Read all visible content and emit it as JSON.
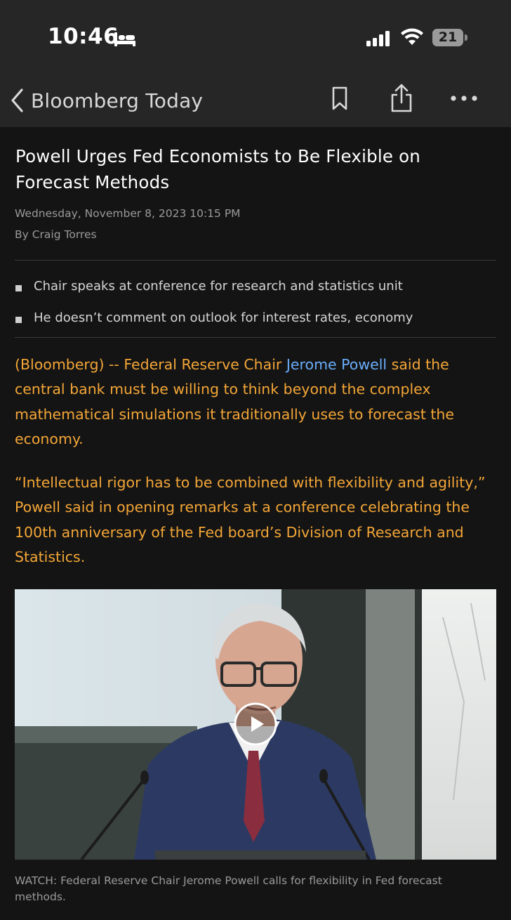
{
  "status_bar": {
    "time": "10:46",
    "battery_percent": "21",
    "battery_level": 0.21,
    "icons": [
      "bed-icon",
      "signal-icon",
      "wifi-icon",
      "battery-icon"
    ]
  },
  "nav": {
    "back_title": "Bloomberg Today",
    "icons": [
      "chevron-left-icon",
      "bookmark-icon",
      "share-icon",
      "more-icon"
    ]
  },
  "article": {
    "headline": "Powell Urges Fed Economists to Be Flexible on Forecast Methods",
    "date": "Wednesday, November 8, 2023 10:15 PM",
    "byline": "By Craig Torres",
    "bullets": [
      "Chair speaks at conference for research and statistics unit",
      "He doesn’t comment on outlook for interest rates, economy"
    ],
    "paragraph1": {
      "before_link": "(Bloomberg) -- Federal Reserve Chair ",
      "link": "Jerome Powell",
      "after_link": " said the central bank must be willing to think beyond the complex mathematical simulations it traditionally uses to forecast the economy."
    },
    "paragraph2": "“Intellectual rigor has to be combined with flexibility and agility,” Powell said in opening remarks at a conference celebrating the 100th anniversary of the Fed board’s Division of Research and Statistics.",
    "video_caption": "WATCH: Federal Reserve Chair Jerome Powell calls for flexibility in Fed forecast methods."
  },
  "colors": {
    "background": "#141414",
    "header": "#262626",
    "body_text": "#f4a637",
    "link": "#6aaefc"
  }
}
